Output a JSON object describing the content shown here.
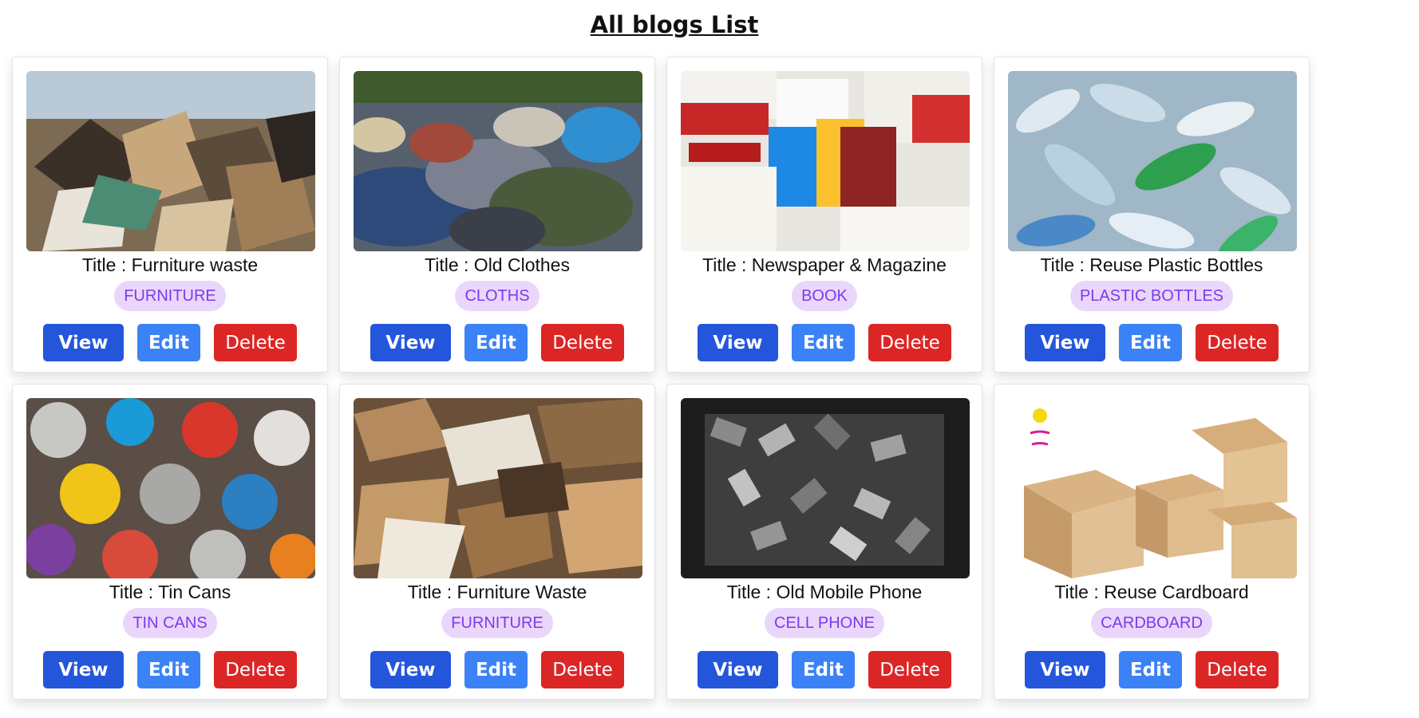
{
  "page": {
    "title": "All blogs List"
  },
  "buttons": {
    "view": "View",
    "edit": "Edit",
    "delete": "Delete"
  },
  "colors": {
    "view_button": "#2456db",
    "edit_button": "#3b82f6",
    "delete_button": "#dc2626",
    "tag_background": "#ead6fb",
    "tag_text": "#7c3aed"
  },
  "blogs": [
    {
      "title": "Title : Furniture waste",
      "tag": "FURNITURE"
    },
    {
      "title": "Title : Old Clothes",
      "tag": "CLOTHS"
    },
    {
      "title": "Title : Newspaper & Magazine",
      "tag": "BOOK"
    },
    {
      "title": "Title : Reuse Plastic Bottles",
      "tag": "PLASTIC BOTTLES"
    },
    {
      "title": "Title : Tin Cans",
      "tag": "TIN CANS"
    },
    {
      "title": "Title : Furniture Waste",
      "tag": "FURNITURE"
    },
    {
      "title": "Title : Old Mobile Phone",
      "tag": "CELL PHONE"
    },
    {
      "title": "Title : Reuse Cardboard",
      "tag": "CARDBOARD"
    }
  ]
}
